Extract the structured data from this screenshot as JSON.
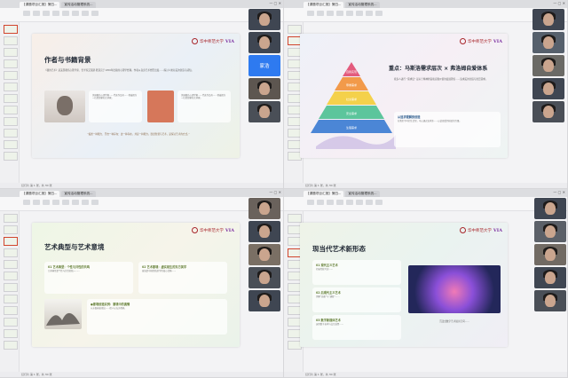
{
  "windows": [
    {
      "id": "q1",
      "tabs": [
        "【课题项目汇报】第四... ",
        "宣传活动管理系统..."
      ],
      "slide_title": "作者与书籍背景",
      "para": "《我的艺术》是美国著名心理学家、哲学家艾瑞斯·默道克于1956年出版的心理学经典，作者从自身艺术经历出发……探讨人类对美的创造与感知。",
      "card_text": "美国著名心理学家……代表作品有……他被视为一位思想家和艺术家。",
      "quote": "“描述一种能力、开启一种存在：这一种存在，并是一种能力。既然智慧与艺术，是探讨艺术的方式。”"
    },
    {
      "id": "q2",
      "tabs": [
        "【课题项目汇报】第四... ",
        "宣传活动管理系统..."
      ],
      "slide_title": "重点：马斯洛需求层次 × 弗洛姆自爱体系",
      "intro": "按多人进行 “需求层” 是关于精神财富和自我价值的发展理论……追求美的创造与欣赏需求。",
      "card_title": "从追求理解到创造",
      "card_text": "在我们平时的生活里，可以通过追求美……以此感受到创造的力量。",
      "pyramid": [
        "自我实现",
        "尊重需求",
        "社交需求",
        "安全需求",
        "生理需求"
      ]
    },
    {
      "id": "q3",
      "tabs": [
        "【课题项目汇报】第四... ",
        "宣传活动管理系统..."
      ],
      "slide_title": "艺术典型与艺术意境",
      "card1_title": "01 艺术典型：个性与共性的共鸣",
      "card1_text": "艺术典型是个性与共性的统一……",
      "card2_title": "02 艺术意境：虚实相生的东方美学",
      "card2_text": "意境是中国传统美学的核心范畴……",
      "bottom_card_title": "●意境创造实例：意境中的真情",
      "bottom_card_text": "从水墨画表现出……给人以无穷想象。"
    },
    {
      "id": "q4",
      "tabs": [
        "【课题项目汇报】第四... ",
        "宣传活动管理系统..."
      ],
      "slide_title": "现当代艺术新形态",
      "items": [
        {
          "title": "01 现代主义艺术",
          "text": "打破传统写实……"
        },
        {
          "title": "02 后现代主义艺术",
          "text": "消解“高雅”与“通俗”……"
        },
        {
          "title": "03 数字新媒体艺术",
          "text": "运用数字技术与交互装置……"
        }
      ],
      "caption": "沉浸式数字艺术展示空间……"
    }
  ],
  "logo": {
    "school": "华中师范大学",
    "brand": "VIA"
  },
  "participant_name": "家浩",
  "status_text": "幻灯片 第 1 张，共 30 张",
  "colors": {
    "accent": "#a8262b",
    "avatar": "#2e7af0",
    "pyramid": [
      "#e35b7d",
      "#f29a4a",
      "#f4d14b",
      "#5cc59c",
      "#4b86d6"
    ]
  }
}
